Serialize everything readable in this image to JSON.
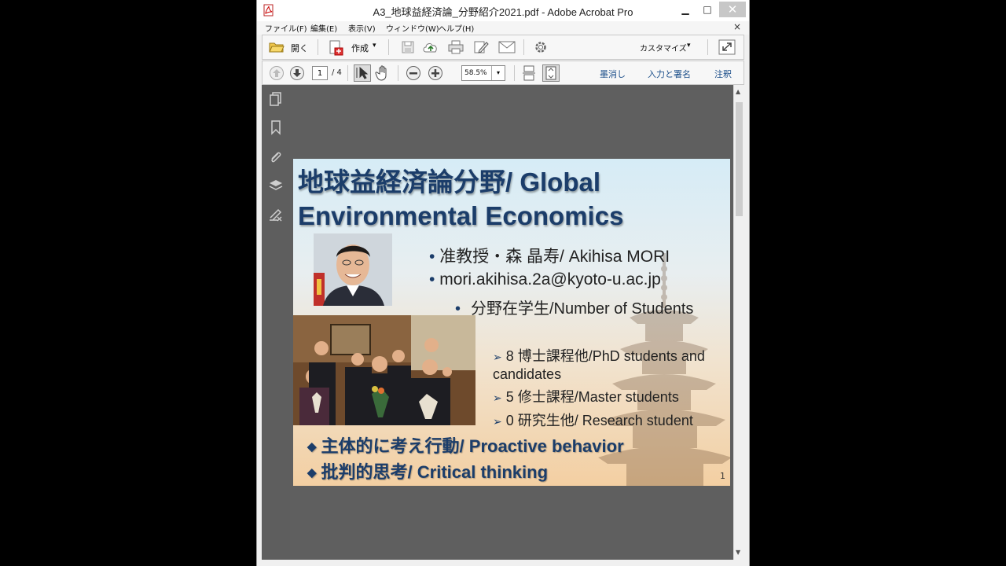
{
  "window": {
    "title": "A3_地球益経済論_分野紹介2021.pdf - Adobe Acrobat Pro",
    "minimize": "▁",
    "maximize": "□",
    "close": "✕"
  },
  "menubar": {
    "items": [
      "ファイル(F)",
      "編集(E)",
      "表示(V)",
      "ウィンドウ(W)",
      "ヘルプ(H)"
    ],
    "close_doc": "×"
  },
  "toolbar1": {
    "open": "開く",
    "create": "作成",
    "create_arrow": "▾",
    "customize": "カスタマイズ",
    "customize_arrow": "▾"
  },
  "toolbar2": {
    "page_current": "1",
    "page_total": "/ 4",
    "zoom": "58.5%",
    "zoom_arrow": "▾",
    "redact": "墨消し",
    "fill_sign": "入力と署名",
    "comment": "注釈"
  },
  "scrollbar": {
    "up": "▲",
    "down": "▼"
  },
  "slide": {
    "title_line1": "地球益経済論分野/ Global",
    "title_line2": "Environmental Economics",
    "bullet1": "准教授・森 晶寿/ Akihisa MORI",
    "bullet2": "mori.akihisa.2a@kyoto-u.ac.jp",
    "bullet3": "分野在学生/Number of Students",
    "sub1": "8 博士課程他/PhD students and candidates",
    "sub2": "5 修士課程/Master students",
    "sub3": "0 研究生他/ Research student",
    "bold1": "主体的に考え行動/ Proactive behavior",
    "bold2": "批判的思考/ Critical thinking",
    "bullet_dot": "•",
    "sub_arrow": "➢",
    "diamond": "◆",
    "page_number": "1"
  },
  "colors": {
    "accent": "#1b3d6a",
    "link": "#1c4f8a",
    "doc_bg": "#5f5f5f"
  }
}
